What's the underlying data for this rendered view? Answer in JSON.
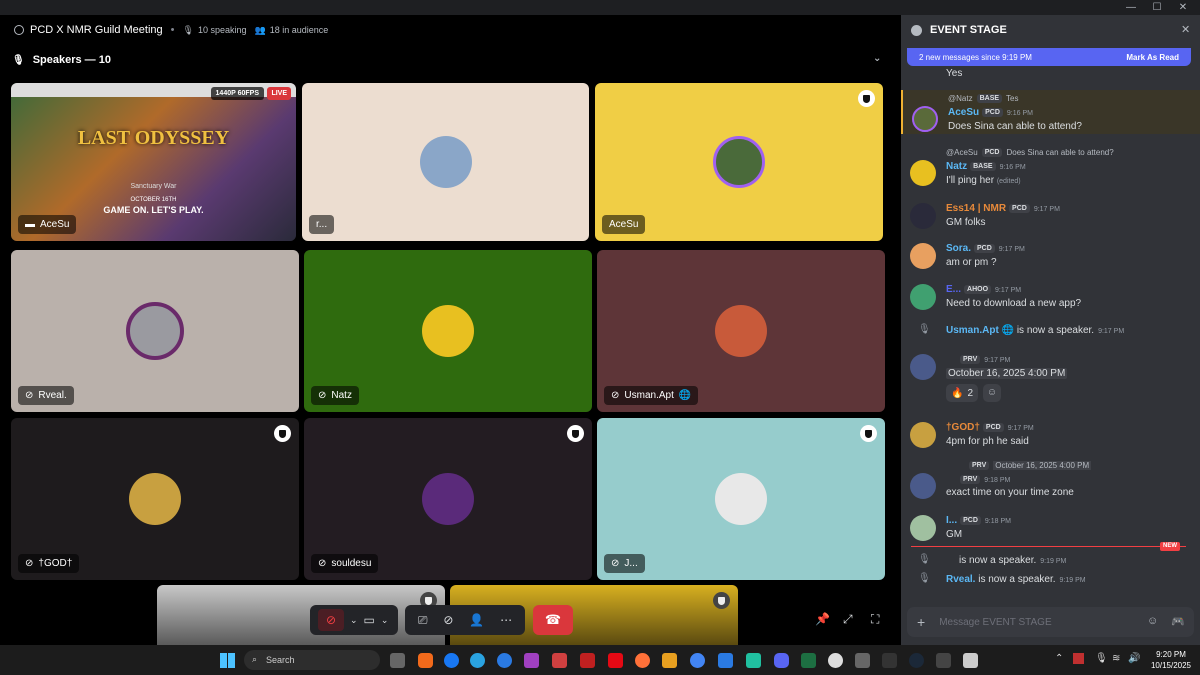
{
  "window": {
    "min": "—",
    "max": "☐",
    "close": "✕"
  },
  "stage": {
    "title": "PCD X NMR Guild Meeting",
    "speaking": "10 speaking",
    "audience": "18 in audience",
    "section": "Speakers — 10"
  },
  "tiles": [
    {
      "name": "AceSu",
      "bg": "#1a1a1a",
      "stream": true,
      "quality": "1440P 60FPS",
      "live": "LIVE",
      "game_title": "LAST ODYSSEY",
      "game_sub": "Sanctuary War",
      "game_date": "OCTOBER 16TH",
      "game_tag": "GAME ON. LET'S PLAY."
    },
    {
      "name": "r...",
      "bg": "#ecddd0"
    },
    {
      "name": "AceSu",
      "bg": "#f0ce45",
      "mod": true
    },
    {
      "name": "Rveal.",
      "bg": "#bab1ab"
    },
    {
      "name": "Natz",
      "bg": "#2f6b0e"
    },
    {
      "name": "Usman.Apt",
      "bg": "#5e3538"
    },
    {
      "name": "†GOD†",
      "bg": "#1e1b1d",
      "mod": true
    },
    {
      "name": "souldesu",
      "bg": "#231c22",
      "mod": true
    },
    {
      "name": "J...",
      "bg": "#96cccc",
      "mod": true
    }
  ],
  "panel": {
    "title": "EVENT STAGE",
    "new_messages": "2 new messages since 9:19 PM",
    "mark_read": "Mark As Read",
    "composer_placeholder": "Message EVENT STAGE",
    "new_label": "NEW"
  },
  "messages": {
    "m0": {
      "text": "Yes"
    },
    "m1": {
      "reply_name": "@Natz",
      "reply_badge": "BASE",
      "reply_text": "Tes",
      "name": "AceSu",
      "badge": "PCD",
      "time": "9:16 PM",
      "text": "Does Sina can able to attend?"
    },
    "m2": {
      "reply_name": "@AceSu",
      "reply_badge": "PCD",
      "reply_text": "Does Sina can able to attend?",
      "name": "Natz",
      "badge": "BASE",
      "time": "9:16 PM",
      "text": "I'll ping her",
      "edited": "(edited)"
    },
    "m3": {
      "name": "Ess14 | NMR",
      "badge": "PCD",
      "time": "9:17 PM",
      "text": "GM folks"
    },
    "m4": {
      "name": "Sora.",
      "badge": "PCD",
      "time": "9:17 PM",
      "text": "am or pm ?"
    },
    "m5": {
      "name": "E...",
      "badge": "AHOO",
      "time": "9:17 PM",
      "text": "Need to download a new app?"
    },
    "m6": {
      "name": "Usman.Apt",
      "text": "is now a speaker.",
      "time": "9:17 PM"
    },
    "m7": {
      "badge": "PRV",
      "time": "9:17 PM",
      "text": "October 16, 2025 4:00 PM",
      "reaction_count": "2"
    },
    "m8": {
      "name": "†GOD†",
      "badge": "PCD",
      "time": "9:17 PM",
      "text": "4pm for ph he said"
    },
    "m9": {
      "reply_badge": "PRV",
      "reply_text": "October 16, 2025 4:00 PM",
      "badge": "PRV",
      "time": "9:18 PM",
      "text": "exact time on your time zone"
    },
    "m10": {
      "name": "I...",
      "badge": "PCD",
      "time": "9:18 PM",
      "text": "GM"
    },
    "m11": {
      "text": "is now a speaker.",
      "time": "9:19 PM"
    },
    "m12": {
      "name": "Rveal.",
      "text": "is now a speaker.",
      "time": "9:19 PM"
    }
  },
  "taskbar": {
    "search": "Search",
    "time": "9:20 PM",
    "date": "10/15/2025"
  }
}
